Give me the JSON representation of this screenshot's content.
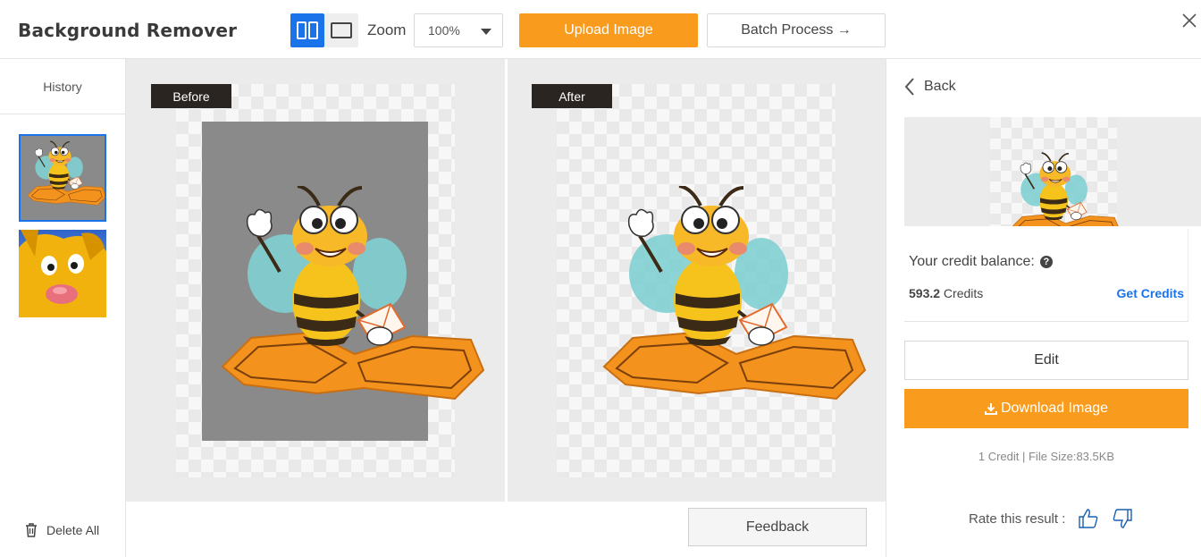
{
  "header": {
    "title": "Background Remover",
    "zoom_label": "Zoom",
    "zoom_value": "100%",
    "upload_label": "Upload Image",
    "batch_label": "Batch Process →"
  },
  "history": {
    "title": "History",
    "delete_all_label": "Delete All"
  },
  "panels": {
    "before_label": "Before",
    "after_label": "After",
    "feedback_label": "Feedback"
  },
  "result": {
    "back_label": "Back",
    "credit_balance_label": "Your credit balance:",
    "credit_amount": "593.2",
    "credit_unit": " Credits",
    "get_credits_label": "Get Credits",
    "edit_label": "Edit",
    "download_label": "Download Image",
    "file_info": "1 Credit | File Size:83.5KB",
    "rate_label": "Rate this result :"
  },
  "colors": {
    "accent_orange": "#f99b1d",
    "accent_blue": "#1a73e8"
  },
  "icons": [
    "split-view-icon",
    "single-view-icon",
    "chevron-down-icon",
    "close-icon",
    "trash-icon",
    "chevron-left-icon",
    "help-icon",
    "download-icon",
    "thumbs-up-icon",
    "thumbs-down-icon"
  ]
}
